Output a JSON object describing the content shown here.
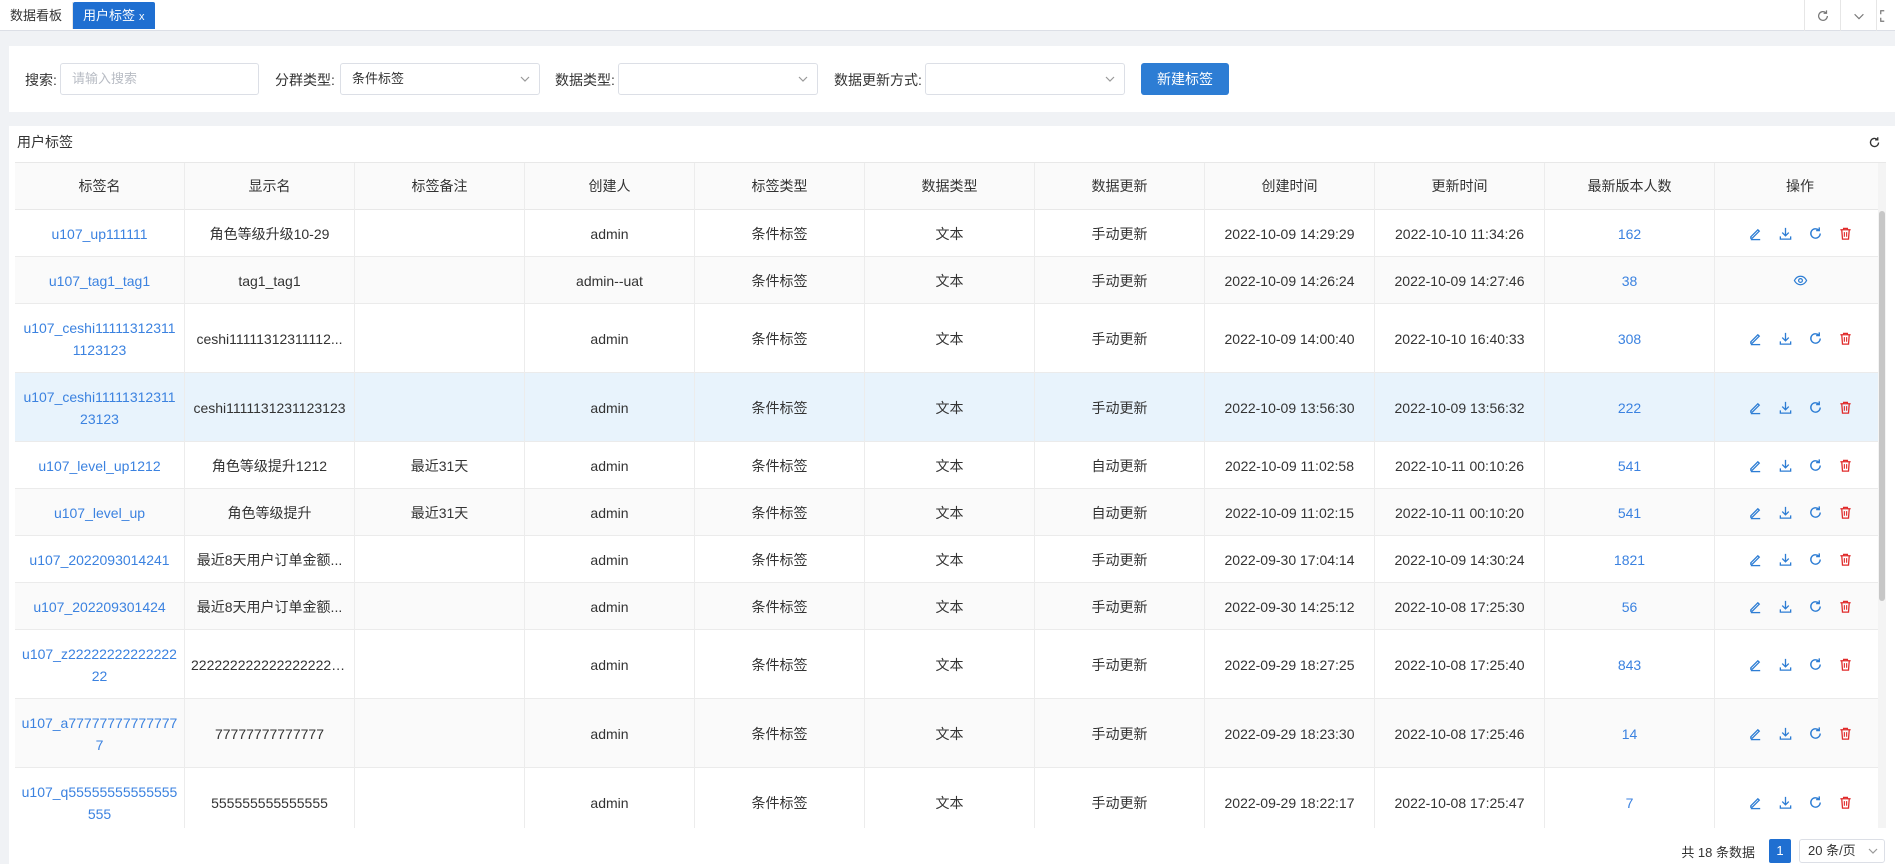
{
  "tabs": {
    "dashboard": "数据看板",
    "user_tags": "用户标签",
    "close_glyph": "x"
  },
  "filters": {
    "search_label": "搜索:",
    "search_placeholder": "请输入搜索",
    "group_type_label": "分群类型:",
    "group_type_value": "条件标签",
    "data_type_label": "数据类型:",
    "data_type_value": "",
    "update_mode_label": "数据更新方式:",
    "update_mode_value": "",
    "new_tag_button": "新建标签"
  },
  "panel": {
    "title": "用户标签"
  },
  "table": {
    "columns": [
      "标签名",
      "显示名",
      "标签备注",
      "创建人",
      "标签类型",
      "数据类型",
      "数据更新",
      "创建时间",
      "更新时间",
      "最新版本人数",
      "操作"
    ],
    "rows": [
      {
        "name": "u107_up111111",
        "display": "角色等级升级10-29",
        "note": "",
        "creator": "admin",
        "tag_type": "条件标签",
        "data_type": "文本",
        "update": "手动更新",
        "created": "2022-10-09 14:29:29",
        "updated": "2022-10-10 11:34:26",
        "count": "162",
        "ops": [
          "edit-icon",
          "download-icon",
          "refresh-icon",
          "delete-icon"
        ]
      },
      {
        "name": "u107_tag1_tag1",
        "display": "tag1_tag1",
        "note": "",
        "creator": "admin--uat",
        "tag_type": "条件标签",
        "data_type": "文本",
        "update": "手动更新",
        "created": "2022-10-09 14:26:24",
        "updated": "2022-10-09 14:27:46",
        "count": "38",
        "ops": [
          "view-icon"
        ]
      },
      {
        "name": "u107_ceshi111113123111123123",
        "display": "ceshi11111312311112...",
        "note": "",
        "creator": "admin",
        "tag_type": "条件标签",
        "data_type": "文本",
        "update": "手动更新",
        "created": "2022-10-09 14:00:40",
        "updated": "2022-10-10 16:40:33",
        "count": "308",
        "ops": [
          "edit-icon",
          "download-icon",
          "refresh-icon",
          "delete-icon"
        ]
      },
      {
        "name": "u107_ceshi1111131231123123",
        "display": "ceshi1111131231123123",
        "note": "",
        "creator": "admin",
        "tag_type": "条件标签",
        "data_type": "文本",
        "update": "手动更新",
        "created": "2022-10-09 13:56:30",
        "updated": "2022-10-09 13:56:32",
        "count": "222",
        "ops": [
          "edit-icon",
          "download-icon",
          "refresh-icon",
          "delete-icon"
        ]
      },
      {
        "name": "u107_level_up1212",
        "display": "角色等级提升1212",
        "note": "最近31天",
        "creator": "admin",
        "tag_type": "条件标签",
        "data_type": "文本",
        "update": "自动更新",
        "created": "2022-10-09 11:02:58",
        "updated": "2022-10-11 00:10:26",
        "count": "541",
        "ops": [
          "edit-icon",
          "download-icon",
          "refresh-icon",
          "delete-icon"
        ]
      },
      {
        "name": "u107_level_up",
        "display": "角色等级提升",
        "note": "最近31天",
        "creator": "admin",
        "tag_type": "条件标签",
        "data_type": "文本",
        "update": "自动更新",
        "created": "2022-10-09 11:02:15",
        "updated": "2022-10-11 00:10:20",
        "count": "541",
        "ops": [
          "edit-icon",
          "download-icon",
          "refresh-icon",
          "delete-icon"
        ]
      },
      {
        "name": "u107_2022093014241",
        "display": "最近8天用户订单金额...",
        "note": "",
        "creator": "admin",
        "tag_type": "条件标签",
        "data_type": "文本",
        "update": "手动更新",
        "created": "2022-09-30 17:04:14",
        "updated": "2022-10-09 14:30:24",
        "count": "1821",
        "ops": [
          "edit-icon",
          "download-icon",
          "refresh-icon",
          "delete-icon"
        ]
      },
      {
        "name": "u107_202209301424",
        "display": "最近8天用户订单金额...",
        "note": "",
        "creator": "admin",
        "tag_type": "条件标签",
        "data_type": "文本",
        "update": "手动更新",
        "created": "2022-09-30 14:25:12",
        "updated": "2022-10-08 17:25:30",
        "count": "56",
        "ops": [
          "edit-icon",
          "download-icon",
          "refresh-icon",
          "delete-icon"
        ]
      },
      {
        "name": "u107_z2222222222222222",
        "display": "2222222222222222222...",
        "note": "",
        "creator": "admin",
        "tag_type": "条件标签",
        "data_type": "文本",
        "update": "手动更新",
        "created": "2022-09-29 18:27:25",
        "updated": "2022-10-08 17:25:40",
        "count": "843",
        "ops": [
          "edit-icon",
          "download-icon",
          "refresh-icon",
          "delete-icon"
        ]
      },
      {
        "name": "u107_a777777777777777",
        "display": "77777777777777",
        "note": "",
        "creator": "admin",
        "tag_type": "条件标签",
        "data_type": "文本",
        "update": "手动更新",
        "created": "2022-09-29 18:23:30",
        "updated": "2022-10-08 17:25:46",
        "count": "14",
        "ops": [
          "edit-icon",
          "download-icon",
          "refresh-icon",
          "delete-icon"
        ]
      },
      {
        "name": "u107_q55555555555555555",
        "display": "555555555555555",
        "note": "",
        "creator": "admin",
        "tag_type": "条件标签",
        "data_type": "文本",
        "update": "手动更新",
        "created": "2022-09-29 18:22:17",
        "updated": "2022-10-08 17:25:47",
        "count": "7",
        "ops": [
          "edit-icon",
          "download-icon",
          "refresh-icon",
          "delete-icon"
        ]
      }
    ]
  },
  "pagination": {
    "total_text": "共 18 条数据",
    "current_page": "1",
    "page_size": "20 条/页"
  },
  "colors": {
    "primary": "#2d7dd4",
    "link": "#3b82e0",
    "danger": "#e02b2b",
    "highlight_row": "#e8f3fc"
  }
}
